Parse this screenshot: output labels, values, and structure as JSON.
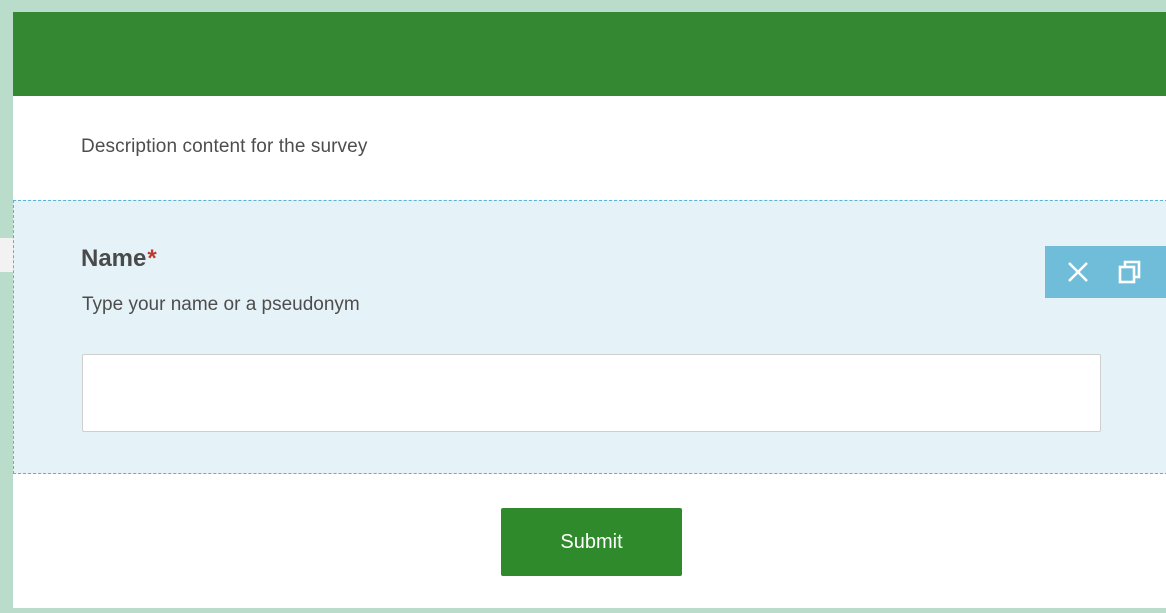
{
  "survey": {
    "description": "Description content for the survey",
    "question": {
      "title": "Name",
      "required_marker": "*",
      "hint": "Type your name or a pseudonym",
      "input_value": ""
    },
    "toolbar": {
      "icons": [
        "close-icon",
        "copy-icon"
      ]
    },
    "submit_label": "Submit"
  },
  "colors": {
    "header": "#338831",
    "question_bg": "#e5f3f8",
    "selection_border": "#58b3d6",
    "tool_strip": "#6fbdd9",
    "submit": "#2f8a2b",
    "required": "#c0392b",
    "page_bg": "#b9dccb"
  }
}
